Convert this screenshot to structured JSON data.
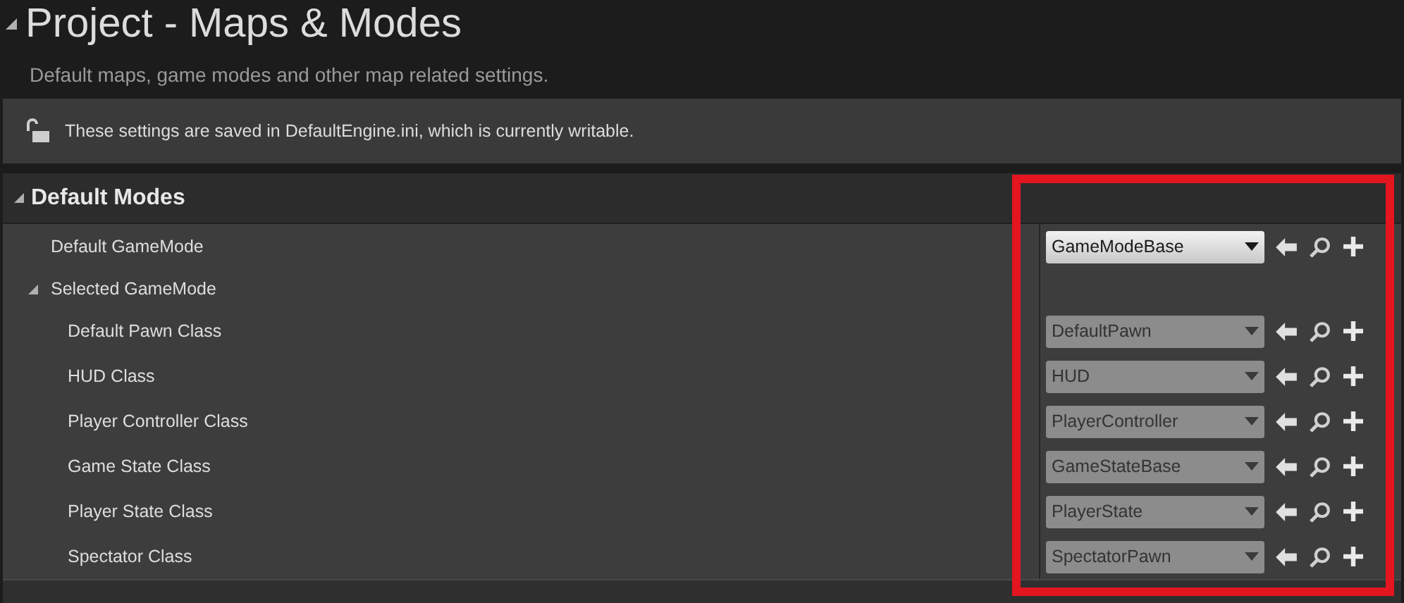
{
  "header": {
    "title": "Project - Maps & Modes",
    "expanded": true,
    "description": "Default maps, game modes and other map related settings."
  },
  "notice": {
    "text": "These settings are saved in DefaultEngine.ini, which is currently writable."
  },
  "section": {
    "title": "Default Modes",
    "expanded": true,
    "properties": [
      {
        "kind": "property",
        "label": "Default GameMode",
        "value": "GameModeBase",
        "disabled": false
      },
      {
        "kind": "group",
        "label": "Selected GameMode",
        "expanded": true,
        "children": [
          {
            "kind": "property",
            "label": "Default Pawn Class",
            "value": "DefaultPawn",
            "disabled": true
          },
          {
            "kind": "property",
            "label": "HUD Class",
            "value": "HUD",
            "disabled": true
          },
          {
            "kind": "property",
            "label": "Player Controller Class",
            "value": "PlayerController",
            "disabled": true
          },
          {
            "kind": "property",
            "label": "Game State Class",
            "value": "GameStateBase",
            "disabled": true
          },
          {
            "kind": "property",
            "label": "Player State Class",
            "value": "PlayerState",
            "disabled": true
          },
          {
            "kind": "property",
            "label": "Spectator Class",
            "value": "SpectatorPawn",
            "disabled": true
          }
        ]
      }
    ]
  }
}
